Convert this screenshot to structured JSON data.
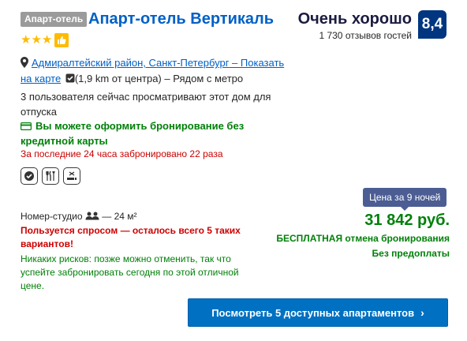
{
  "listing": {
    "type_badge": "Апарт-отель",
    "title": "Апарт-отель Вертикаль",
    "star_count": 3,
    "rating_word": "Очень хорошо",
    "reviews": "1 730 отзывов гостей",
    "score": "8,4",
    "location": {
      "area_link": "Адмиралтейский район, Санкт-Петербург",
      "show_map_link": "Показать на карте",
      "distance": "(1,9 km от центра)",
      "metro": "– Рядом с метро"
    },
    "viewing_now": "3 пользователя сейчас просматривают этот дом для отпуска",
    "no_card": "Вы можете оформить бронирование без кредитной карты",
    "booked_recently": "За последние 24 часа забронировано 22 раза",
    "facilities": [
      "wifi-icon",
      "restaurant-icon",
      "no-smoking-icon"
    ]
  },
  "offer": {
    "nights_badge": "Цена за 9 ночей",
    "price": "31 842 руб.",
    "free_cancel": "БЕСПЛАТНАЯ отмена бронирования",
    "no_prepay": "Без предоплаты",
    "room_type": "Номер-студио",
    "room_size": "— 24 м²",
    "demand_warning": "Пользуется спросом — осталось всего 5 таких вариантов!",
    "no_risk": "Никаких рисков: позже можно отменить, так что успейте забронировать сегодня по этой отличной цене.",
    "cta_label": "Посмотреть 5 доступных апартаментов"
  },
  "colors": {
    "link_blue": "#0060c7",
    "score_bg": "#003580",
    "green": "#008009",
    "red": "#cc0000",
    "star_yellow": "#febb02",
    "nights_badge_bg": "#4b5d93",
    "cta_bg": "#0071c2"
  }
}
